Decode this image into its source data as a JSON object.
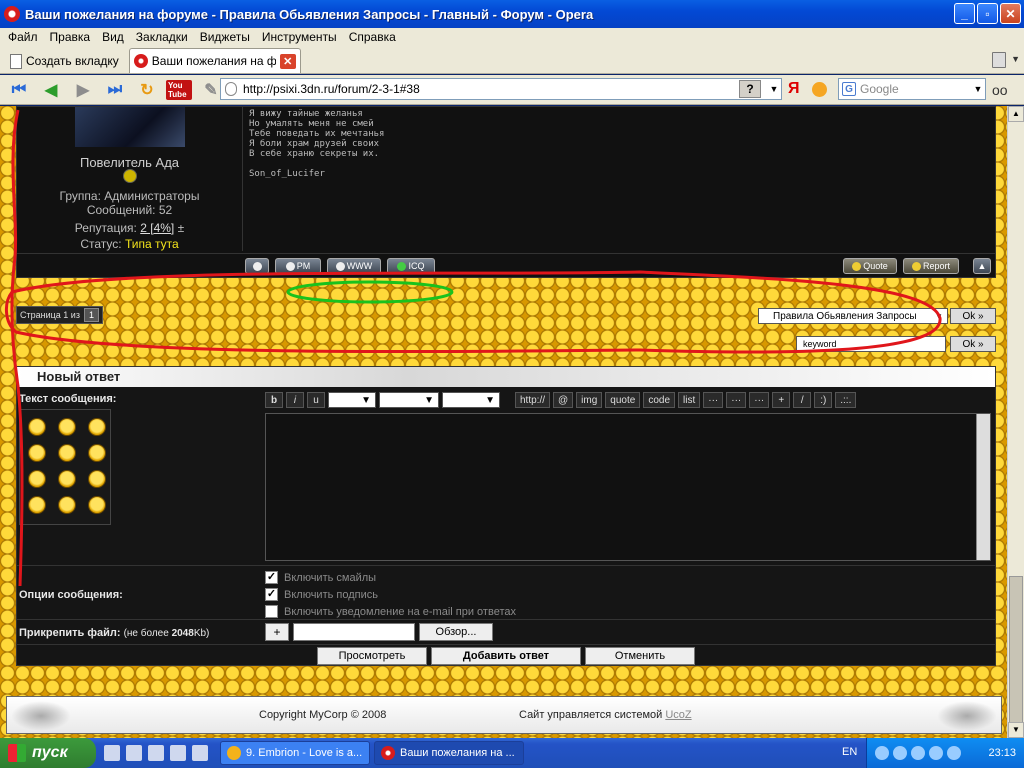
{
  "window": {
    "title": "Ваши пожелания на форуме - Правила Обьявления Запросы - Главный - Форум - Opera"
  },
  "menu": [
    "Файл",
    "Правка",
    "Вид",
    "Закладки",
    "Виджеты",
    "Инструменты",
    "Справка"
  ],
  "tabs": {
    "new_tab_label": "Создать вкладку",
    "active_tab_label": "Ваши пожелания на фо..."
  },
  "nav": {
    "url": "http://psixi.3dn.ru/forum/2-3-1#38",
    "search_placeholder": "Google",
    "help_label": "?",
    "yandex_label": "Я",
    "youtube_label": "You Tube"
  },
  "post": {
    "author": "Повелитель Ада",
    "group_label": "Группа:",
    "group_value": "Администраторы",
    "posts_label": "Сообщений:",
    "posts_value": "52",
    "rep_label": "Репутация:",
    "rep_value": "2 [4%]",
    "rep_pm": "±",
    "status_label": "Статус:",
    "status_value": "Типа тута",
    "message_lines": [
      "Я вижу тайные желанья",
      "Но умалять меня не смей",
      "Тебе поведать их мечтанья",
      "Я боли храм друзей своих",
      "В себе храню секреты их."
    ],
    "signature": "Son_of_Lucifer",
    "buttons": {
      "pm": "PM",
      "www": "WWW",
      "icq": "ICQ",
      "quote": "Quote",
      "report": "Report"
    }
  },
  "pager": {
    "label": "Страница 1 из",
    "page": "1"
  },
  "jump": {
    "selected": "Правила Обьявления Запросы",
    "ok": "Ok »",
    "search_value": "keyword",
    "search_ok": "Ok »"
  },
  "reply": {
    "title": "Новый ответ",
    "message_label": "Текст сообщения:",
    "options_label": "Опции сообщения:",
    "attach_label": "Прикрепить файл:",
    "attach_limit_pre": "(не более ",
    "attach_limit_size": "2048",
    "attach_limit_unit": "Kb)",
    "toolbar": [
      "b",
      "i",
      "u",
      "http://",
      "@",
      "img",
      "quote",
      "code",
      "list",
      "···",
      "···",
      "···",
      "+",
      "/",
      ":)",
      ".::."
    ],
    "options": [
      {
        "label": "Включить смайлы",
        "checked": true
      },
      {
        "label": "Включить подпись",
        "checked": true
      },
      {
        "label": "Включить уведомление на e-mail при ответах",
        "checked": false
      }
    ],
    "plus": "+",
    "browse": "Обзор...",
    "preview": "Просмотреть",
    "submit": "Добавить ответ",
    "cancel": "Отменить"
  },
  "footer": {
    "copyright": "Copyright MyCorp © 2008",
    "powered": "Сайт управляется системой",
    "powered_link": "UcoZ"
  },
  "taskbar": {
    "start": "пуск",
    "task1": "9. Embrion - Love is a...",
    "task2": "Ваши пожелания на ...",
    "lang": "EN",
    "clock": "23:13"
  },
  "colors": {
    "annotation_red": "#e0161b",
    "annotation_green": "#19c21d",
    "status_yellow": "#f3e31c"
  }
}
